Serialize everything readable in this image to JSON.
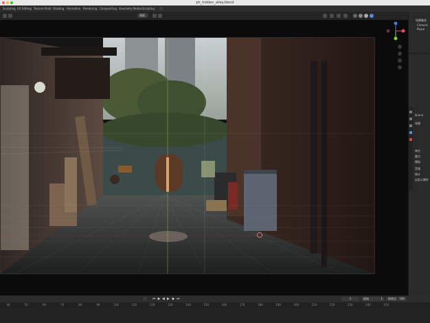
{
  "window": {
    "title": "ph_hidden_alley.blend"
  },
  "workspaces": [
    "Sculpting",
    "UV Editing",
    "Texture Paint",
    "Shading",
    "Animation",
    "Rendering",
    "Compositing",
    "Geometry Nodes",
    "Scripting"
  ],
  "header": {
    "view_dropdown": "视图"
  },
  "outliner": {
    "title": "场景集合",
    "rows": [
      "Camera",
      "Plane"
    ]
  },
  "properties": {
    "scene_label": "Scene",
    "sections": [
      "场景",
      "单位",
      "重力",
      "模拟",
      "音频",
      "统计",
      "自定义属性"
    ]
  },
  "timeline": {
    "ticks": [
      "40",
      "50",
      "60",
      "70",
      "80",
      "90",
      "100",
      "110",
      "120",
      "130",
      "140",
      "150",
      "160",
      "170",
      "180",
      "190",
      "200",
      "210",
      "220",
      "230",
      "240",
      "250"
    ],
    "current_frame": "1",
    "start_label": "起始",
    "start_value": "1",
    "end_label": "结束点",
    "end_value": "180"
  },
  "icons": [
    "play-icon",
    "jump-start-icon",
    "jump-end-icon",
    "keyframe-prev-icon",
    "keyframe-next-icon",
    "record-icon",
    "gizmo-x-axis",
    "gizmo-y-axis",
    "gizmo-z-axis",
    "zoom-icon",
    "hand-icon",
    "camera-icon",
    "grid-icon"
  ],
  "colors": {
    "gizmo_x": "#e84a5f",
    "gizmo_y": "#8dcc3c",
    "gizmo_z": "#3d7fe0",
    "frame_line": "#e8b93c"
  }
}
